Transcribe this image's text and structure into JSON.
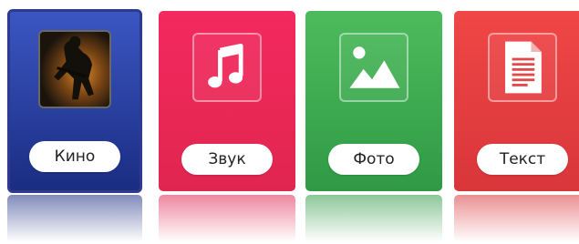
{
  "tiles": [
    {
      "id": "kino",
      "label": "Кино",
      "icon": "film-poster-icon",
      "color_top": "#3b56c2",
      "color_bottom": "#1a2d82",
      "selected": true
    },
    {
      "id": "zvuk",
      "label": "Звук",
      "icon": "music-note-icon",
      "color_top": "#f4295f",
      "color_bottom": "#e0264f",
      "selected": false
    },
    {
      "id": "foto",
      "label": "Фото",
      "icon": "image-icon",
      "color_top": "#4dbb5c",
      "color_bottom": "#2f9a45",
      "selected": false
    },
    {
      "id": "tekst",
      "label": "Текст",
      "icon": "document-icon",
      "color_top": "#f04646",
      "color_bottom": "#d9363a",
      "selected": false
    }
  ]
}
